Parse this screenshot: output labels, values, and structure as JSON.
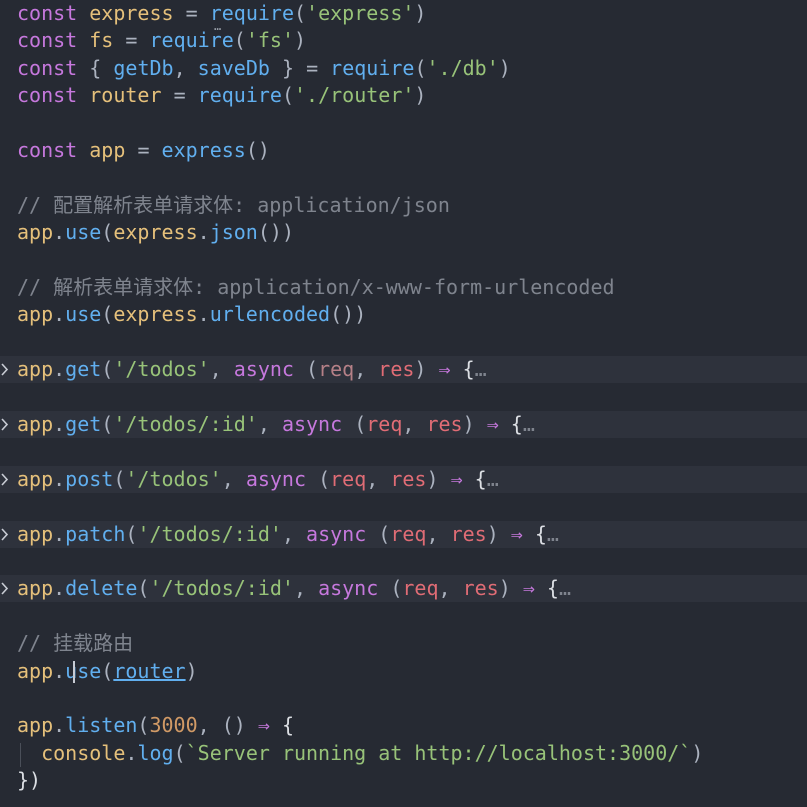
{
  "editor": {
    "lines": [
      {
        "kind": "code",
        "tokens": [
          [
            "kw",
            "const"
          ],
          [
            "t",
            " "
          ],
          [
            "var",
            "express"
          ],
          [
            "t",
            " "
          ],
          [
            "punc",
            "="
          ],
          [
            "t",
            " "
          ],
          [
            "fn",
            "require"
          ],
          [
            "punc",
            "("
          ],
          [
            "str",
            "'express'"
          ],
          [
            "punc",
            ")"
          ]
        ]
      },
      {
        "kind": "code",
        "tokens": [
          [
            "kw",
            "const"
          ],
          [
            "t",
            " "
          ],
          [
            "var",
            "fs"
          ],
          [
            "t",
            " "
          ],
          [
            "punc",
            "="
          ],
          [
            "t",
            " "
          ],
          [
            "fn",
            "require"
          ],
          [
            "punc",
            "("
          ],
          [
            "str",
            "'fs'"
          ],
          [
            "punc",
            ")"
          ]
        ]
      },
      {
        "kind": "code",
        "tokens": [
          [
            "kw",
            "const"
          ],
          [
            "t",
            " "
          ],
          [
            "punc",
            "{"
          ],
          [
            "t",
            " "
          ],
          [
            "fn",
            "getDb"
          ],
          [
            "punc",
            ","
          ],
          [
            "t",
            " "
          ],
          [
            "fn",
            "saveDb"
          ],
          [
            "t",
            " "
          ],
          [
            "punc",
            "}"
          ],
          [
            "t",
            " "
          ],
          [
            "punc",
            "="
          ],
          [
            "t",
            " "
          ],
          [
            "fn",
            "require"
          ],
          [
            "punc",
            "("
          ],
          [
            "str",
            "'./db'"
          ],
          [
            "punc",
            ")"
          ]
        ]
      },
      {
        "kind": "code",
        "tokens": [
          [
            "kw",
            "const"
          ],
          [
            "t",
            " "
          ],
          [
            "var",
            "router"
          ],
          [
            "t",
            " "
          ],
          [
            "punc",
            "="
          ],
          [
            "t",
            " "
          ],
          [
            "fn",
            "require"
          ],
          [
            "punc",
            "("
          ],
          [
            "str",
            "'./router'"
          ],
          [
            "punc",
            ")"
          ]
        ]
      },
      {
        "kind": "blank"
      },
      {
        "kind": "code",
        "tokens": [
          [
            "kw",
            "const"
          ],
          [
            "t",
            " "
          ],
          [
            "var",
            "app"
          ],
          [
            "t",
            " "
          ],
          [
            "punc",
            "="
          ],
          [
            "t",
            " "
          ],
          [
            "fn",
            "express"
          ],
          [
            "punc",
            "()"
          ]
        ]
      },
      {
        "kind": "blank"
      },
      {
        "kind": "code",
        "tokens": [
          [
            "cmt",
            "// 配置解析表单请求体: application/json"
          ]
        ]
      },
      {
        "kind": "code",
        "tokens": [
          [
            "var",
            "app"
          ],
          [
            "punc",
            "."
          ],
          [
            "fn",
            "use"
          ],
          [
            "punc",
            "("
          ],
          [
            "var",
            "express"
          ],
          [
            "punc",
            "."
          ],
          [
            "fn",
            "json"
          ],
          [
            "punc",
            "())"
          ]
        ]
      },
      {
        "kind": "blank"
      },
      {
        "kind": "code",
        "tokens": [
          [
            "cmt",
            "// 解析表单请求体: application/x-www-form-urlencoded"
          ]
        ]
      },
      {
        "kind": "code",
        "tokens": [
          [
            "var",
            "app"
          ],
          [
            "punc",
            "."
          ],
          [
            "fn",
            "use"
          ],
          [
            "punc",
            "("
          ],
          [
            "var",
            "express"
          ],
          [
            "punc",
            "."
          ],
          [
            "fn",
            "urlencoded"
          ],
          [
            "punc",
            "())"
          ]
        ]
      },
      {
        "kind": "blank"
      },
      {
        "kind": "folded",
        "tokens": [
          [
            "var",
            "app"
          ],
          [
            "punc",
            "."
          ],
          [
            "fn",
            "get"
          ],
          [
            "punc",
            "("
          ],
          [
            "str",
            "'/todos'"
          ],
          [
            "punc",
            ","
          ],
          [
            "t",
            " "
          ],
          [
            "kw",
            "async"
          ],
          [
            "t",
            " "
          ],
          [
            "punc",
            "("
          ],
          [
            "param-dim",
            "req"
          ],
          [
            "punc",
            ","
          ],
          [
            "t",
            " "
          ],
          [
            "param",
            "res"
          ],
          [
            "punc",
            ")"
          ],
          [
            "t",
            " "
          ],
          [
            "arrow",
            "⇒"
          ],
          [
            "t",
            " "
          ],
          [
            "brace",
            "{"
          ],
          [
            "ellipsis",
            "…"
          ]
        ]
      },
      {
        "kind": "blank"
      },
      {
        "kind": "folded",
        "tokens": [
          [
            "var",
            "app"
          ],
          [
            "punc",
            "."
          ],
          [
            "fn",
            "get"
          ],
          [
            "punc",
            "("
          ],
          [
            "str",
            "'/todos/:id'"
          ],
          [
            "punc",
            ","
          ],
          [
            "t",
            " "
          ],
          [
            "kw",
            "async"
          ],
          [
            "t",
            " "
          ],
          [
            "punc",
            "("
          ],
          [
            "param",
            "req"
          ],
          [
            "punc",
            ","
          ],
          [
            "t",
            " "
          ],
          [
            "param",
            "res"
          ],
          [
            "punc",
            ")"
          ],
          [
            "t",
            " "
          ],
          [
            "arrow",
            "⇒"
          ],
          [
            "t",
            " "
          ],
          [
            "brace",
            "{"
          ],
          [
            "ellipsis",
            "…"
          ]
        ]
      },
      {
        "kind": "blank"
      },
      {
        "kind": "folded",
        "tokens": [
          [
            "var",
            "app"
          ],
          [
            "punc",
            "."
          ],
          [
            "fn",
            "post"
          ],
          [
            "punc",
            "("
          ],
          [
            "str",
            "'/todos'"
          ],
          [
            "punc",
            ","
          ],
          [
            "t",
            " "
          ],
          [
            "kw",
            "async"
          ],
          [
            "t",
            " "
          ],
          [
            "punc",
            "("
          ],
          [
            "param",
            "req"
          ],
          [
            "punc",
            ","
          ],
          [
            "t",
            " "
          ],
          [
            "param",
            "res"
          ],
          [
            "punc",
            ")"
          ],
          [
            "t",
            " "
          ],
          [
            "arrow",
            "⇒"
          ],
          [
            "t",
            " "
          ],
          [
            "brace",
            "{"
          ],
          [
            "ellipsis",
            "…"
          ]
        ]
      },
      {
        "kind": "blank"
      },
      {
        "kind": "folded",
        "tokens": [
          [
            "var",
            "app"
          ],
          [
            "punc",
            "."
          ],
          [
            "fn",
            "patch"
          ],
          [
            "punc",
            "("
          ],
          [
            "str",
            "'/todos/:id'"
          ],
          [
            "punc",
            ","
          ],
          [
            "t",
            " "
          ],
          [
            "kw",
            "async"
          ],
          [
            "t",
            " "
          ],
          [
            "punc",
            "("
          ],
          [
            "param",
            "req"
          ],
          [
            "punc",
            ","
          ],
          [
            "t",
            " "
          ],
          [
            "param",
            "res"
          ],
          [
            "punc",
            ")"
          ],
          [
            "t",
            " "
          ],
          [
            "arrow",
            "⇒"
          ],
          [
            "t",
            " "
          ],
          [
            "brace",
            "{"
          ],
          [
            "ellipsis",
            "…"
          ]
        ]
      },
      {
        "kind": "blank"
      },
      {
        "kind": "folded",
        "tokens": [
          [
            "var",
            "app"
          ],
          [
            "punc",
            "."
          ],
          [
            "fn",
            "delete"
          ],
          [
            "punc",
            "("
          ],
          [
            "str",
            "'/todos/:id'"
          ],
          [
            "punc",
            ","
          ],
          [
            "t",
            " "
          ],
          [
            "kw",
            "async"
          ],
          [
            "t",
            " "
          ],
          [
            "punc",
            "("
          ],
          [
            "param",
            "req"
          ],
          [
            "punc",
            ","
          ],
          [
            "t",
            " "
          ],
          [
            "param",
            "res"
          ],
          [
            "punc",
            ")"
          ],
          [
            "t",
            " "
          ],
          [
            "arrow",
            "⇒"
          ],
          [
            "t",
            " "
          ],
          [
            "brace",
            "{"
          ],
          [
            "ellipsis",
            "…"
          ]
        ]
      },
      {
        "kind": "blank"
      },
      {
        "kind": "code",
        "tokens": [
          [
            "cmt",
            "// 挂载路由"
          ]
        ]
      },
      {
        "kind": "code",
        "tokens": [
          [
            "var",
            "app"
          ],
          [
            "punc",
            "."
          ],
          [
            "fn",
            "use"
          ],
          [
            "punc",
            "("
          ],
          [
            "link",
            "router"
          ],
          [
            "punc",
            ")"
          ]
        ]
      },
      {
        "kind": "blank"
      },
      {
        "kind": "code",
        "tokens": [
          [
            "var",
            "app"
          ],
          [
            "punc",
            "."
          ],
          [
            "fn",
            "listen"
          ],
          [
            "punc",
            "("
          ],
          [
            "num",
            "3000"
          ],
          [
            "punc",
            ","
          ],
          [
            "t",
            " "
          ],
          [
            "punc",
            "()"
          ],
          [
            "t",
            " "
          ],
          [
            "arrow",
            "⇒"
          ],
          [
            "t",
            " "
          ],
          [
            "brace",
            "{"
          ]
        ]
      },
      {
        "kind": "code",
        "tokens": [
          [
            "t",
            "  "
          ],
          [
            "var",
            "console"
          ],
          [
            "punc",
            "."
          ],
          [
            "fn",
            "log"
          ],
          [
            "punc",
            "("
          ],
          [
            "str",
            "`Server running at http://localhost:3000/`"
          ],
          [
            "punc",
            ")"
          ]
        ]
      },
      {
        "kind": "code",
        "tokens": [
          [
            "brace",
            "})"
          ]
        ]
      }
    ]
  },
  "theme": {
    "background": "#262a33",
    "folded_line_bg": "#2e323c",
    "keyword": "#c678dd",
    "variable": "#e5c07b",
    "function": "#61afef",
    "string": "#98c379",
    "parameter": "#e06c75",
    "number": "#d19a66",
    "comment": "#7f848e"
  },
  "icons": {
    "fold": "chevron-right-icon"
  }
}
